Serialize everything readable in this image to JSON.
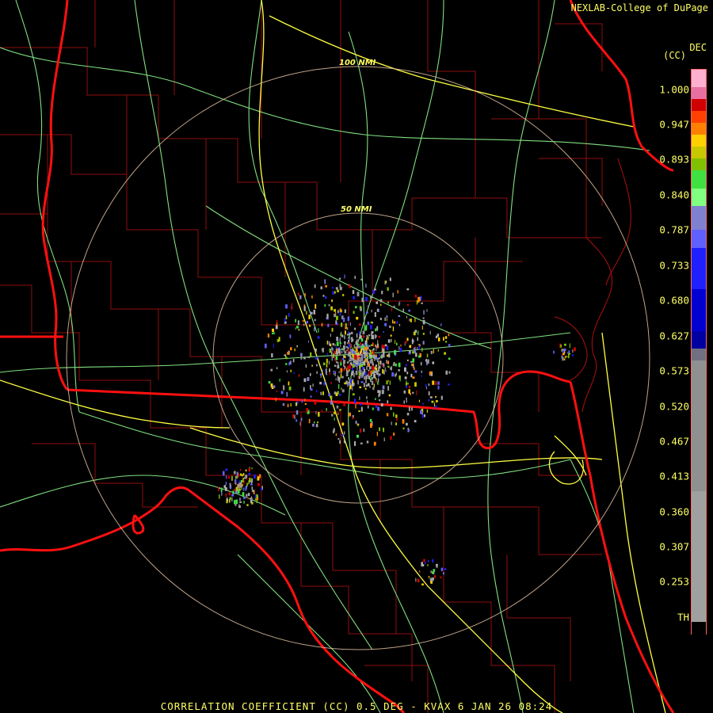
{
  "header": {
    "credit": "NEXLAB-College of DuPage",
    "product_unit": "(CC)",
    "corner_label": "DEC"
  },
  "range_rings": [
    {
      "label": "100 NMI"
    },
    {
      "label": "50 NMI"
    }
  ],
  "legend": {
    "labels": [
      "1.000",
      "0.947",
      "0.893",
      "0.840",
      "0.787",
      "0.733",
      "0.680",
      "0.627",
      "0.573",
      "0.520",
      "0.467",
      "0.413",
      "0.360",
      "0.307",
      "0.253",
      "TH"
    ],
    "color_scale": [
      "#ffb0d0",
      "#e870a0",
      "#d00000",
      "#ff4000",
      "#ff8000",
      "#ffd000",
      "#c8c800",
      "#80c000",
      "#40e040",
      "#80ff80",
      "#8080d0",
      "#6060ff",
      "#2020ff",
      "#0000d0",
      "#0000a0",
      "#707080",
      "#909090",
      "#a0a0a0",
      "#000000"
    ]
  },
  "footer": {
    "caption": "CORRELATION COEFFICIENT (CC) 0.5 DEG - KVAX 6 JAN 26 08:24"
  },
  "colors": {
    "state_border": "#ff1010",
    "county_border": "#b01010",
    "highway_green": "#80e080",
    "highway_yellow": "#ffff40",
    "range_ring": "#e0c0a0",
    "text": "#ffff66"
  }
}
